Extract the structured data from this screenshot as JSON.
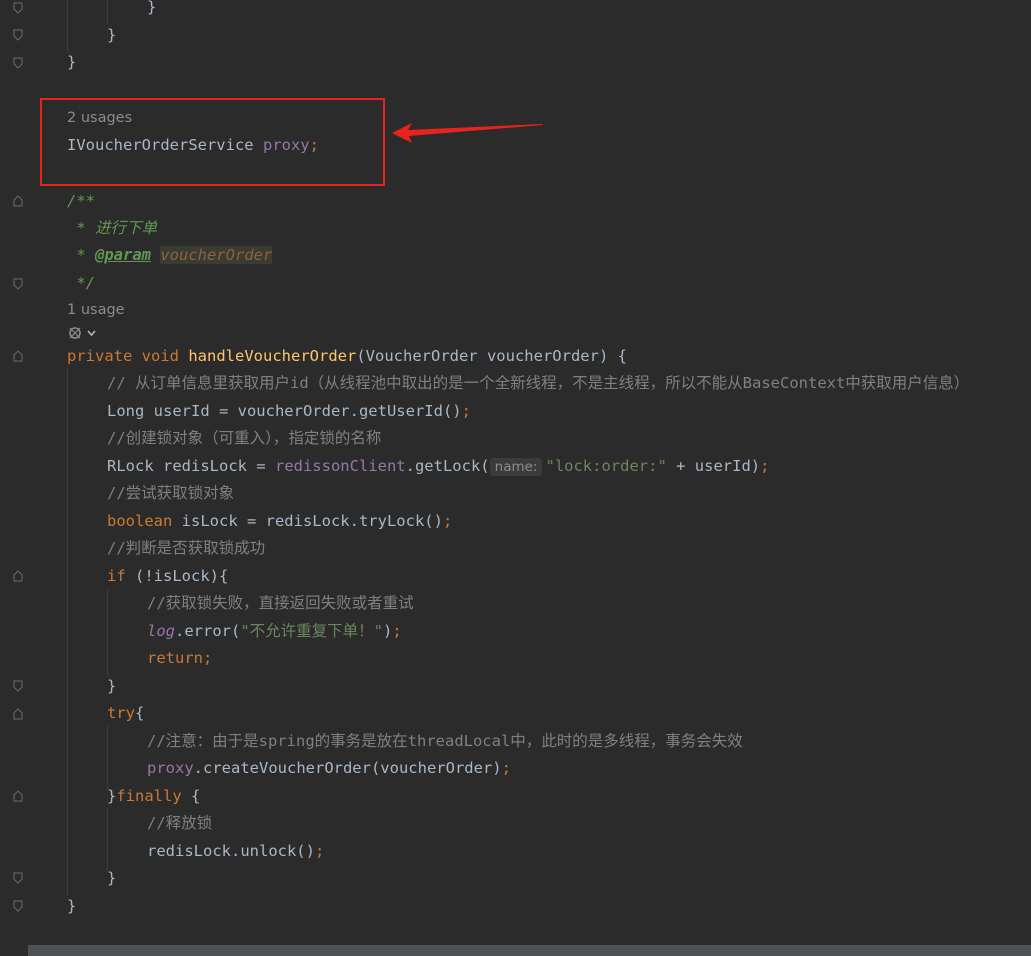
{
  "editor": {
    "usages_proxy": "2 usages",
    "usages_method": "1 usage",
    "closing_braces": [
      "}",
      "}",
      "}"
    ],
    "field_decl": {
      "type": "IVoucherOrderService",
      "name": "proxy",
      "semicolon": ";"
    },
    "javadoc": {
      "open": "/**",
      "line1": " * 进行下单",
      "param_prefix": " * ",
      "param_tag": "@param",
      "param_name": "voucherOrder",
      "close": " */"
    },
    "method": {
      "modifier": "private",
      "return_type": "void",
      "name": "handleVoucherOrder",
      "params": "(VoucherOrder voucherOrder) {"
    },
    "body": {
      "c1": "// 从订单信息里获取用户id（从线程池中取出的是一个全新线程，不是主线程，所以不能从BaseContext中获取用户信息）",
      "l1": "Long userId = voucherOrder.getUserId()",
      "c2": "//创建锁对象（可重入），指定锁的名称",
      "l2_pre": "RLock redisLock = ",
      "l2_field": "redissonClient",
      "l2_call": ".getLock(",
      "l2_hint": "name:",
      "l2_str": "\"lock:order:\"",
      "l2_post": " + userId)",
      "c3": "//尝试获取锁对象",
      "l3_kw": "boolean",
      "l3_rest": " isLock = redisLock.tryLock()",
      "c4": "//判断是否获取锁成功",
      "l4_kw": "if",
      "l4_rest": " (!isLock){",
      "c5": "//获取锁失败，直接返回失败或者重试",
      "l5_log": "log",
      "l5_call": ".error(",
      "l5_str": "\"不允许重复下单！\"",
      "l5_post": ")",
      "l6_kw": "return",
      "brace_close": "}",
      "l7_kw": "try",
      "l7_brace": "{",
      "c6": "//注意：由于是spring的事务是放在threadLocal中，此时的是多线程，事务会失效",
      "l8_field": "proxy",
      "l8_rest": ".createVoucherOrder(voucherOrder)",
      "l9_brace": "}",
      "l9_kw": "finally",
      "l9_post": " {",
      "c7": "//释放锁",
      "l10": "redisLock.unlock()",
      "semi": ";"
    }
  },
  "annotation": {
    "box_color": "#e8231d",
    "arrow_color": "#e8231d"
  },
  "colors": {
    "background": "#2b2b2b",
    "keyword": "#cc7832",
    "method_name": "#ffc66d",
    "field": "#9876aa",
    "string": "#6a8759",
    "comment": "#808080",
    "doc_comment": "#629755"
  }
}
